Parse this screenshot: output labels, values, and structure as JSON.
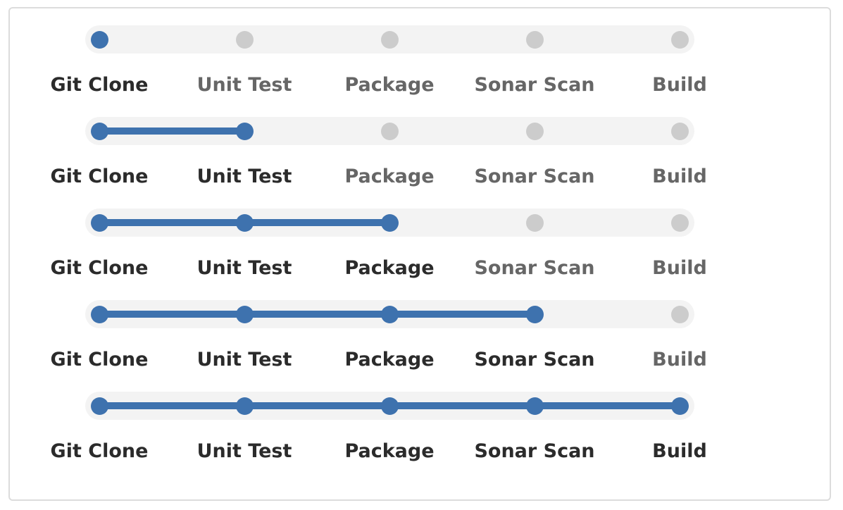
{
  "steps": [
    "Git Clone",
    "Unit Test",
    "Package",
    "Sonar Scan",
    "Build"
  ],
  "rows": [
    {
      "progress_step": 1
    },
    {
      "progress_step": 2
    },
    {
      "progress_step": 3
    },
    {
      "progress_step": 4
    },
    {
      "progress_step": 5
    }
  ],
  "colors": {
    "active": "#3e72ae",
    "inactive_dot": "#cccccc",
    "track": "#f3f3f3",
    "label_active": "#2b2b2b",
    "label_inactive": "#666666"
  }
}
